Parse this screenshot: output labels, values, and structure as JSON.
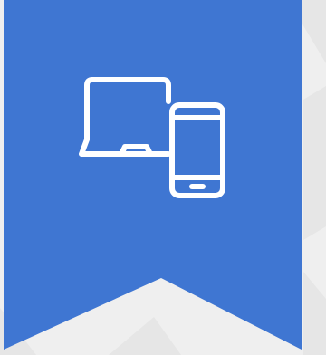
{
  "banner": {
    "color": "#3f76d2",
    "background_color": "#efefef",
    "background_stripe_color": "#e6e6e6",
    "icon": "laptop-and-smartphone-icon",
    "icon_color": "#ffffff"
  }
}
